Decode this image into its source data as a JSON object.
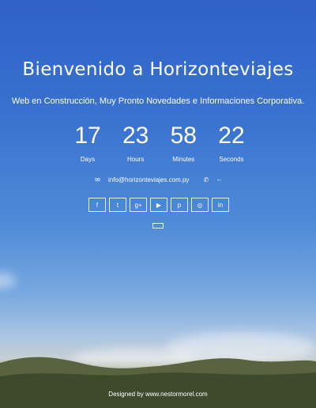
{
  "title": "Bienvenido a Horizonteviajes",
  "subtitle": "Web en Construcción, Muy Pronto Novedades e Informaciones Corporativa.",
  "countdown": [
    {
      "value": "17",
      "label": "Days"
    },
    {
      "value": "23",
      "label": "Hours"
    },
    {
      "value": "58",
      "label": "Minutes"
    },
    {
      "value": "22",
      "label": "Seconds"
    }
  ],
  "contact": {
    "email": "info@horizonteviajes.com.py",
    "phone": "--"
  },
  "social": [
    {
      "icon": "facebook-icon",
      "glyph": "f"
    },
    {
      "icon": "twitter-icon",
      "glyph": "t"
    },
    {
      "icon": "google-plus-icon",
      "glyph": "g+"
    },
    {
      "icon": "youtube-icon",
      "glyph": "▶"
    },
    {
      "icon": "pinterest-icon",
      "glyph": "p"
    },
    {
      "icon": "instagram-icon",
      "glyph": "◎"
    },
    {
      "icon": "linkedin-icon",
      "glyph": "in"
    }
  ],
  "footer": "Designed by www.nestormorel.com"
}
